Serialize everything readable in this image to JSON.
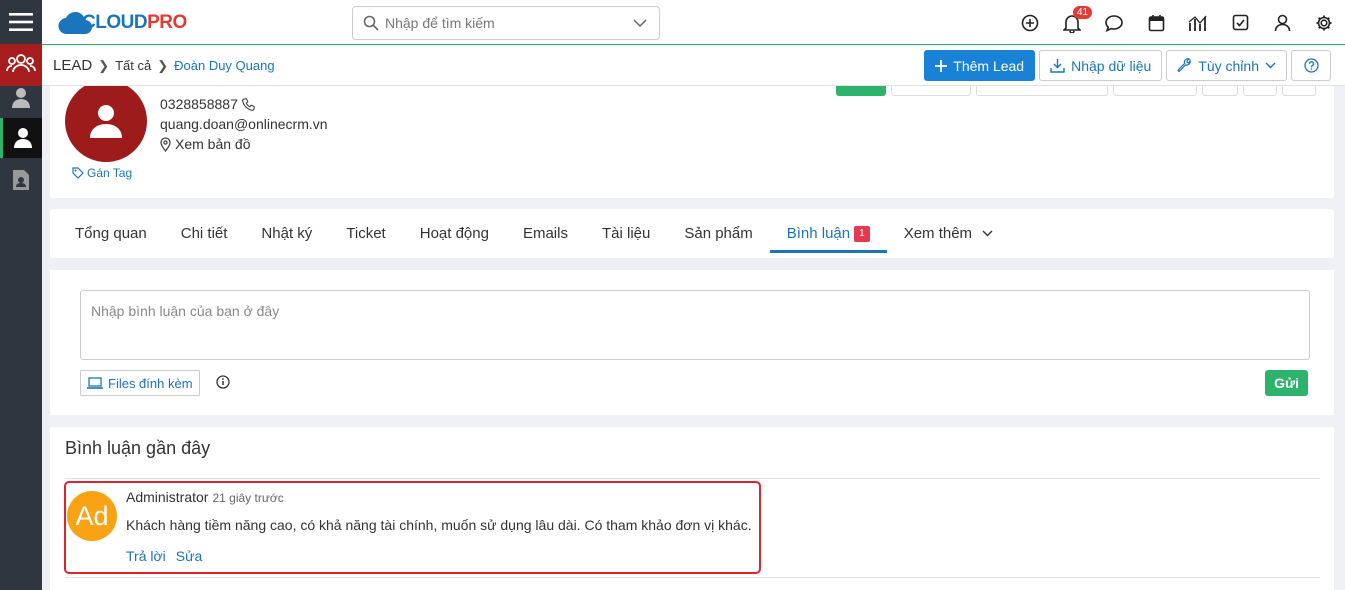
{
  "logo": {
    "brand_cloud": "CLOUD",
    "brand_pro": "PRO"
  },
  "search": {
    "placeholder": "Nhập để tìm kiếm"
  },
  "notifications": {
    "count": "41"
  },
  "breadcrumb": {
    "module": "LEAD",
    "list": "Tất cả",
    "record": "Đoàn Duy Quang"
  },
  "actions": {
    "add_lead": "Thêm Lead",
    "import": "Nhập dữ liệu",
    "customize": "Tùy chỉnh"
  },
  "profile": {
    "phone": "0328858887",
    "email": "quang.doan@onlinecrm.vn",
    "map": "Xem bản đồ",
    "tag": "Gán Tag"
  },
  "tabs": [
    {
      "label": "Tổng quan"
    },
    {
      "label": "Chi tiết"
    },
    {
      "label": "Nhật ký"
    },
    {
      "label": "Ticket"
    },
    {
      "label": "Hoạt động"
    },
    {
      "label": "Emails"
    },
    {
      "label": "Tài liệu"
    },
    {
      "label": "Sản phẩm"
    },
    {
      "label": "Bình luận",
      "count": "1"
    },
    {
      "label": "Xem thêm"
    }
  ],
  "composer": {
    "placeholder": "Nhập bình luận của bạn ở đây",
    "attach_label": "Files đính kèm",
    "send_label": "Gửi"
  },
  "recent": {
    "title": "Bình luận gần đây",
    "comment": {
      "avatar_initials": "Ad",
      "author": "Administrator",
      "time": "21 giây trước",
      "text": "Khách hàng tiềm năng cao, có khả năng tài chính, muốn sử dụng lâu dài. Có tham khảo đơn vị khác.",
      "reply": "Trả lời",
      "edit": "Sửa"
    }
  },
  "colors": {
    "primary": "#1a82d6",
    "success": "#2db36b",
    "danger": "#e53935",
    "avatar_bg": "#9e1b1b",
    "comment_avatar": "#f9a314"
  }
}
